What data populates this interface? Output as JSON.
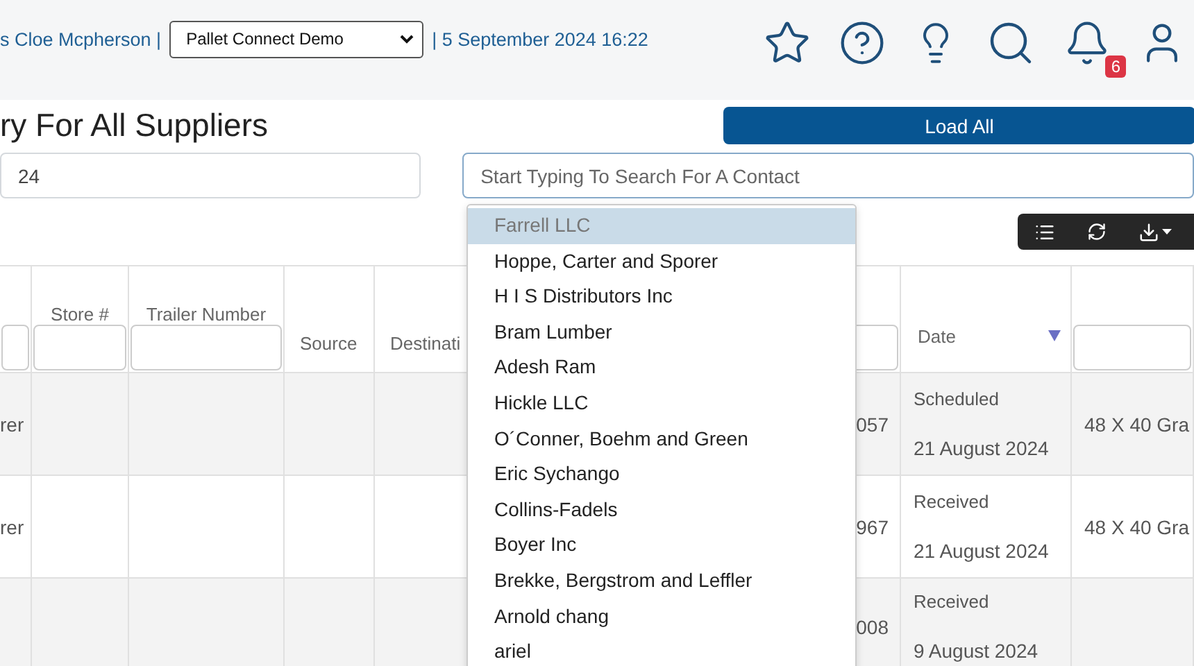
{
  "header": {
    "user": "s Cloe Mcpherson |",
    "company_select": "Pallet Connect Demo",
    "datetime": "| 5 September 2024 16:22",
    "notification_count": "6"
  },
  "page": {
    "title": "ry For All Suppliers",
    "load_button": "Load All",
    "date_field": {
      "value": "24"
    },
    "contact_search": {
      "placeholder": "Start Typing To Search For A Contact"
    }
  },
  "contact_dropdown": [
    {
      "label": "Farrell LLC",
      "selected": true
    },
    {
      "label": "Hoppe, Carter and Sporer",
      "selected": false
    },
    {
      "label": "H I S Distributors Inc",
      "selected": false
    },
    {
      "label": "Bram Lumber",
      "selected": false
    },
    {
      "label": "Adesh Ram",
      "selected": false
    },
    {
      "label": "Hickle LLC",
      "selected": false
    },
    {
      "label": "O´Conner, Boehm and Green",
      "selected": false
    },
    {
      "label": "Eric Sychango",
      "selected": false
    },
    {
      "label": "Collins-Fadels",
      "selected": false
    },
    {
      "label": "Boyer Inc",
      "selected": false
    },
    {
      "label": "Brekke, Bergstrom and Leffler",
      "selected": false
    },
    {
      "label": "Arnold chang",
      "selected": false
    },
    {
      "label": "ariel",
      "selected": false
    }
  ],
  "table": {
    "columns": [
      {
        "kind": "filter"
      },
      {
        "kind": "filter",
        "label": "Store #"
      },
      {
        "kind": "filter",
        "label": "Trailer Number"
      },
      {
        "kind": "plain",
        "label": "Source"
      },
      {
        "kind": "plain",
        "label": "Destinati"
      },
      {
        "kind": "filter"
      },
      {
        "kind": "sort",
        "label": "Date"
      },
      {
        "kind": "filter"
      }
    ],
    "rows": [
      {
        "column_1": "rer",
        "column_6": "057",
        "status": "Scheduled",
        "date": "21 August 2024",
        "column_8": "48 X 40 Gra"
      },
      {
        "column_1": "rer",
        "column_6": "967",
        "status": "Received",
        "date": "21 August 2024",
        "column_8": "48 X 40 Gra"
      },
      {
        "column_6": "008",
        "status": "Received",
        "date": "9 August 2024"
      }
    ]
  }
}
